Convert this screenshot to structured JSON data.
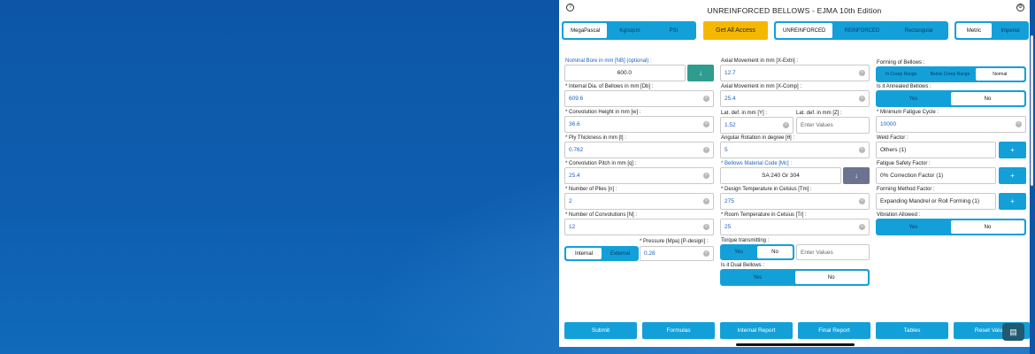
{
  "header": {
    "title": "UNREINFORCED BELLOWS - EJMA 10th Edition",
    "help_glyph": "?",
    "settings_glyph": "⚙"
  },
  "units_pressure": [
    "MegaPascal",
    "Kg/sqcm",
    "PSI"
  ],
  "get_access_label": "Get All Access",
  "bellows_type": [
    "UNREINFORCED",
    "REINFORCED",
    "Rectangular"
  ],
  "units_system": [
    "Metric",
    "Imperial"
  ],
  "col1": {
    "nb_label": "Nominal Bore in mm [NB] (optional) :",
    "nb_value": "600.0",
    "db_label": "* Internal Dia. of Bellows in mm [Db] :",
    "db_value": "609.6",
    "w_label": "* Convolution Height in mm [w] :",
    "w_value": "36.6",
    "t_label": "* Ply Thickness in mm [t] :",
    "t_value": "0.762",
    "q_label": "* Convolution Pitch in mm [q] :",
    "q_value": "25.4",
    "n_label": "* Number of Plies [n] :",
    "n_value": "2",
    "N_label": "* Number of Convolutions [N] :",
    "N_value": "12",
    "pressure_type": [
      "Internal",
      "External"
    ],
    "p_label": "* Pressure (Mpa) [P-design] :",
    "p_value": "0.28"
  },
  "col2": {
    "x_extn_label": "Axial Movement in mm [X-Extn] :",
    "x_extn_value": "12.7",
    "x_comp_label": "Axial Movement in mm [X-Comp] :",
    "x_comp_value": "25.4",
    "y_label": "Lat. def. in mm [Y] :",
    "y_value": "1.52",
    "z_label": "Lat. def. in mm [Z] :",
    "z_placeholder": "Enter Values",
    "theta_label": "Angular Rotation in degree [θ] :",
    "theta_value": "5",
    "mat_label": "* Bellows Material Code [Mc] :",
    "mat_value": "SA 240 Gr 304",
    "tm_label": "* Design Temperature in Celsius [Tm] :",
    "tm_value": "275",
    "tr_label": "* Room Temperature in Celsius [Tr] :",
    "tr_value": "25",
    "torque_label": "Torque transmitting :",
    "torque_opts": [
      "Yes",
      "No"
    ],
    "torque_placeholder": "Enter Values",
    "dual_label": "Is it Dual Bellows :",
    "dual_opts": [
      "Yes",
      "No"
    ]
  },
  "col3": {
    "forming_label": "Forming of Bellows :",
    "forming_opts": [
      "In Creep Range",
      "Below Creep Range",
      "Normal"
    ],
    "annealed_label": "Is it Annealed Bellows :",
    "annealed_opts": [
      "Yes",
      "No"
    ],
    "fatigue_label": "* Minimum Fatigue Cycle :",
    "fatigue_value": "10000",
    "weld_label": "Weld Factor :",
    "weld_value": "Others (1)",
    "fsf_label": "Fatigue Safety Factor :",
    "fsf_value": "0% Correction Factor (1)",
    "fmf_label": "Forming Method Factor :",
    "fmf_value": "Expanding Mandrel or Roll Forming (1)",
    "vib_label": "Vibration Allowed :",
    "vib_opts": [
      "Yes",
      "No"
    ]
  },
  "actions": [
    "Submit",
    "Formulas",
    "Internal Report",
    "Final Report",
    "Tables",
    "Reset Values"
  ],
  "glyphs": {
    "clear": "×",
    "down": "↓",
    "plus": "+",
    "fab": "▤"
  },
  "colors": {
    "accent": "#13a0d8",
    "gold": "#f5b800",
    "teal": "#2e9c8e",
    "background": "#0f5aa8"
  }
}
